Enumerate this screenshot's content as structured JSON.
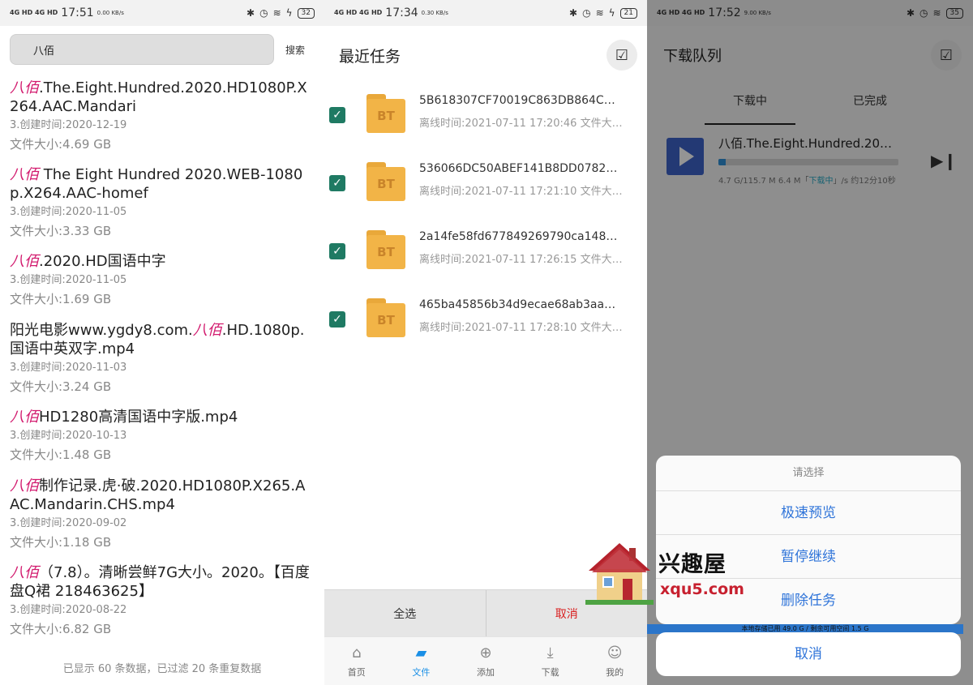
{
  "panel1": {
    "status": {
      "signal": "4G HD 4G HD",
      "time": "17:51",
      "speed": "0.00 KB/s",
      "icons": [
        "bluetooth-icon",
        "alarm-icon",
        "wifi-icon",
        "charging-icon"
      ],
      "battery": "32"
    },
    "search": {
      "value": "八佰",
      "button": "搜索"
    },
    "results": [
      {
        "hl": "八佰",
        "rest": ".The.Eight.Hundred.2020.HD1080P.X264.AAC.Mandari",
        "date": "3.创建时间:2020-12-19",
        "size": "文件大小:4.69 GB"
      },
      {
        "hl": "八佰",
        "rest": " The Eight Hundred 2020.WEB-1080p.X264.AAC-homef",
        "date": "3.创建时间:2020-11-05",
        "size": "文件大小:3.33 GB"
      },
      {
        "hl": "八佰",
        "rest": ".2020.HD国语中字",
        "date": "3.创建时间:2020-11-05",
        "size": "文件大小:1.69 GB"
      },
      {
        "pre": "阳光电影www.ygdy8.com.",
        "hl": "八佰",
        "rest": ".HD.1080p.国语中英双字.mp4",
        "date": "3.创建时间:2020-11-03",
        "size": "文件大小:3.24 GB"
      },
      {
        "hl": "八佰",
        "rest": "HD1280高清国语中字版.mp4",
        "date": "3.创建时间:2020-10-13",
        "size": "文件大小:1.48 GB"
      },
      {
        "hl": "八佰",
        "rest": "制作记录.虎·破.2020.HD1080P.X265.AAC.Mandarin.CHS.mp4",
        "date": "3.创建时间:2020-09-02",
        "size": "文件大小:1.18 GB"
      },
      {
        "hl": "八佰",
        "rest": "（7.8）。清晰尝鲜7G大小。2020。【百度盘Q裙 218463625】",
        "date": "3.创建时间:2020-08-22",
        "size": "文件大小:6.82 GB"
      }
    ],
    "footer": "已显示 60 条数据，已过滤 20 条重复数据"
  },
  "panel2": {
    "status": {
      "signal": "4G HD 4G HD",
      "time": "17:34",
      "speed": "0.30 KB/s",
      "battery": "21"
    },
    "title": "最近任务",
    "tasks": [
      {
        "name": "5B618307CF70019C863DB864C…",
        "sub": "离线时间:2021-07-11 17:20:46 文件大…",
        "badge": "BT"
      },
      {
        "name": "536066DC50ABEF141B8DD0782…",
        "sub": "离线时间:2021-07-11 17:21:10 文件大小…",
        "badge": "BT"
      },
      {
        "name": "2a14fe58fd677849269790ca148…",
        "sub": "离线时间:2021-07-11 17:26:15 文件大…",
        "badge": "BT"
      },
      {
        "name": "465ba45856b34d9ecae68ab3aa…",
        "sub": "离线时间:2021-07-11 17:28:10 文件大…",
        "badge": "BT"
      }
    ],
    "actions": {
      "select_all": "全选",
      "cancel": "取消"
    },
    "tabs": [
      {
        "label": "首页",
        "icon": "home-icon"
      },
      {
        "label": "文件",
        "icon": "folder-icon",
        "active": true
      },
      {
        "label": "添加",
        "icon": "add-icon"
      },
      {
        "label": "下载",
        "icon": "download-icon"
      },
      {
        "label": "我的",
        "icon": "profile-icon"
      }
    ]
  },
  "watermark": {
    "title": "兴趣屋",
    "url": "xqu5.com"
  },
  "panel3": {
    "status": {
      "signal": "4G HD 4G HD",
      "time": "17:52",
      "speed": "9.00 KB/s",
      "battery": "35"
    },
    "title": "下载队列",
    "tabs": [
      "下载中",
      "已完成"
    ],
    "download": {
      "name": "八佰.The.Eight.Hundred.2020.…",
      "progress_fraction": 0.04,
      "meta_pre": "4.7 G/115.7 M 6.4 M「",
      "meta_state": "下载中",
      "meta_post": "」/s 约12分10秒"
    },
    "sheet": {
      "title": "请选择",
      "options": [
        "极速预览",
        "暂停继续",
        "删除任务"
      ],
      "cancel": "取消"
    },
    "storage": "本地存储已用 49.0 G / 剩余可用空间 1.5 G"
  }
}
